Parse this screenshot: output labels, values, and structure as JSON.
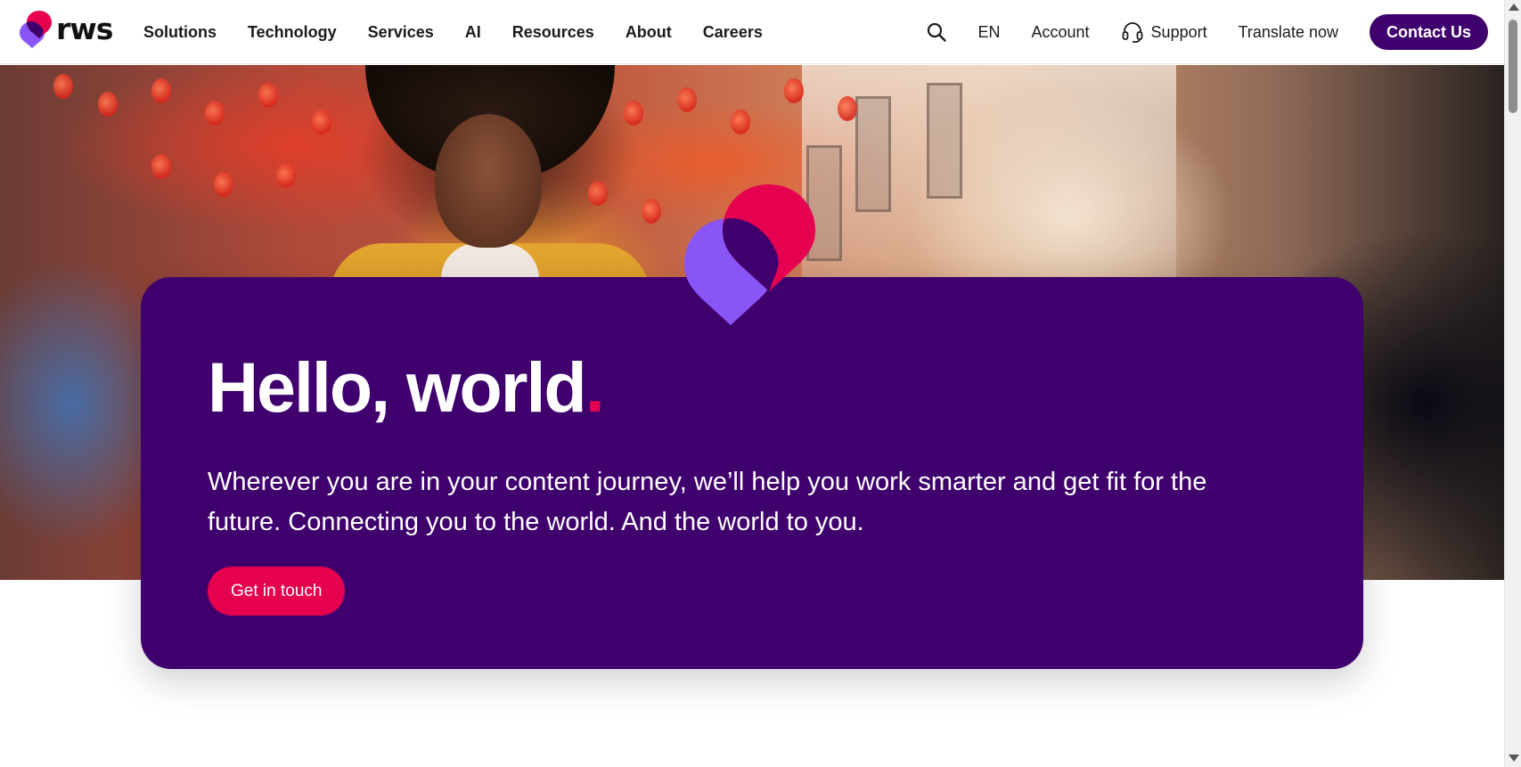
{
  "header": {
    "logo_text": "rws",
    "nav": [
      "Solutions",
      "Technology",
      "Services",
      "AI",
      "Resources",
      "About",
      "Careers"
    ],
    "language": "EN",
    "account": "Account",
    "support": "Support",
    "translate_now": "Translate now",
    "contact": "Contact Us"
  },
  "hero": {
    "title": "Hello, world",
    "title_dot": ".",
    "text": "Wherever you are in your content journey, we’ll help you work smarter and get fit for the future. Connecting you to the world. And the world to you.",
    "cta": "Get in touch"
  },
  "colors": {
    "brand_purple": "#3f006e",
    "brand_pink": "#e60050",
    "logo_violet": "#8a55f7"
  },
  "icons": [
    "search-icon",
    "headset-icon",
    "rws-logo-icon"
  ]
}
